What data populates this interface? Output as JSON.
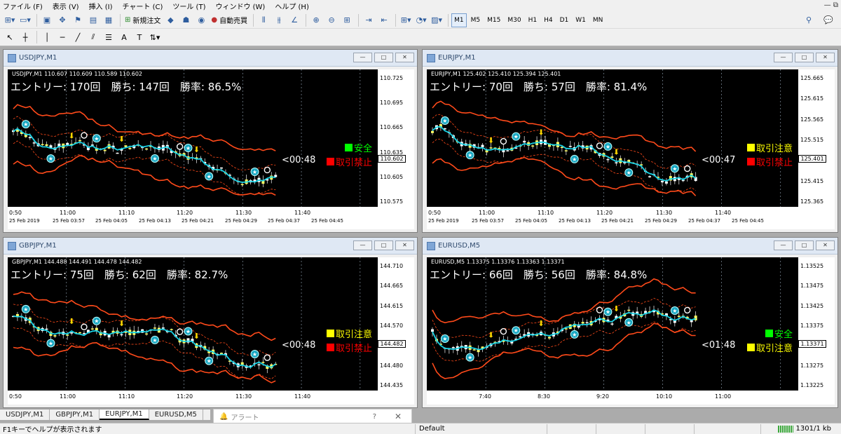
{
  "menu": [
    "ファイル (F)",
    "表示 (V)",
    "挿入 (I)",
    "チャート (C)",
    "ツール (T)",
    "ウィンドウ (W)",
    "ヘルプ (H)"
  ],
  "toolbar": {
    "new_order": "新規注文",
    "auto_trade": "自動売買",
    "timeframes": [
      "M1",
      "M5",
      "M15",
      "M30",
      "H1",
      "H4",
      "D1",
      "W1",
      "MN"
    ],
    "active_timeframe": "M1"
  },
  "charts": [
    {
      "title": "USDJPY,M1",
      "info": "USDJPY,M1  110.607 110.609 110.589 110.602",
      "stats": "エントリー: 170回　勝ち: 147回　勝率: 86.5%",
      "timer": "<00:48",
      "alerts": [
        {
          "text": "安全",
          "color": "#00ff00"
        },
        {
          "text": "取引禁止",
          "color": "#ff0000"
        }
      ],
      "prices": [
        "110.725",
        "110.695",
        "110.665",
        "110.635",
        "110.605",
        "110.575"
      ],
      "current_price": "110.602",
      "axis_left": "0:50",
      "axis_times": [
        "11:00",
        "11:10",
        "11:20",
        "11:30",
        "11:40"
      ],
      "dates": [
        "25 Feb 2019",
        "25 Feb 03:57",
        "25 Feb 04:05",
        "25 Feb 04:13",
        "25 Feb 04:21",
        "25 Feb 04:29",
        "25 Feb 04:37",
        "25 Feb 04:45"
      ],
      "seed": 1
    },
    {
      "title": "EURJPY,M1",
      "info": "EURJPY,M1  125.402 125.410 125.394 125.401",
      "stats": "エントリー: 70回　勝ち: 57回　勝率: 81.4%",
      "timer": "<00:47",
      "alerts": [
        {
          "text": "取引注意",
          "color": "#ffff00"
        },
        {
          "text": "取引禁止",
          "color": "#ff0000"
        }
      ],
      "prices": [
        "125.665",
        "125.615",
        "125.565",
        "125.515",
        "125.465",
        "125.415",
        "125.365"
      ],
      "current_price": "125.401",
      "axis_left": "0:50",
      "axis_times": [
        "11:00",
        "11:10",
        "11:20",
        "11:30",
        "11:40"
      ],
      "dates": [
        "25 Feb 2019",
        "25 Feb 03:57",
        "25 Feb 04:05",
        "25 Feb 04:13",
        "25 Feb 04:21",
        "25 Feb 04:29",
        "25 Feb 04:37",
        "25 Feb 04:45"
      ],
      "seed": 2
    },
    {
      "title": "GBPJPY,M1",
      "info": "GBPJPY,M1  144.488 144.491 144.478 144.482",
      "stats": "エントリー: 75回　勝ち: 62回　勝率: 82.7%",
      "timer": "<00:48",
      "alerts": [
        {
          "text": "取引注意",
          "color": "#ffff00"
        },
        {
          "text": "取引禁止",
          "color": "#ff0000"
        }
      ],
      "prices": [
        "144.710",
        "144.665",
        "144.615",
        "144.570",
        "144.525",
        "144.480",
        "144.435"
      ],
      "current_price": "144.482",
      "axis_left": "0:50",
      "axis_times": [
        "11:00",
        "11:10",
        "11:20",
        "11:30",
        "11:40"
      ],
      "dates": [],
      "seed": 3
    },
    {
      "title": "EURUSD,M5",
      "info": "EURUSD,M5  1.13375 1.13376 1.13363 1.13371",
      "stats": "エントリー: 66回　勝ち: 56回　勝率: 84.8%",
      "timer": "<01:48",
      "alerts": [
        {
          "text": "安全",
          "color": "#00ff00"
        },
        {
          "text": "取引注意",
          "color": "#ffff00"
        }
      ],
      "prices": [
        "1.13525",
        "1.13475",
        "1.13425",
        "1.13375",
        "1.13325",
        "1.13275",
        "1.13225"
      ],
      "current_price": "1.13371",
      "axis_left": "",
      "axis_times": [
        "7:40",
        "8:30",
        "9:20",
        "10:10",
        "11:00"
      ],
      "dates": [],
      "seed": 4
    }
  ],
  "tabs": [
    "USDJPY,M1",
    "GBPJPY,M1",
    "EURJPY,M1",
    "EURUSD,M5"
  ],
  "active_tab": "EURJPY,M1",
  "alert_panel": {
    "title": "アラート",
    "help": "?",
    "close": "✕"
  },
  "status": {
    "help": "F1キーでヘルプが表示されます",
    "profile": "Default",
    "traffic": "1301/1 kb"
  }
}
